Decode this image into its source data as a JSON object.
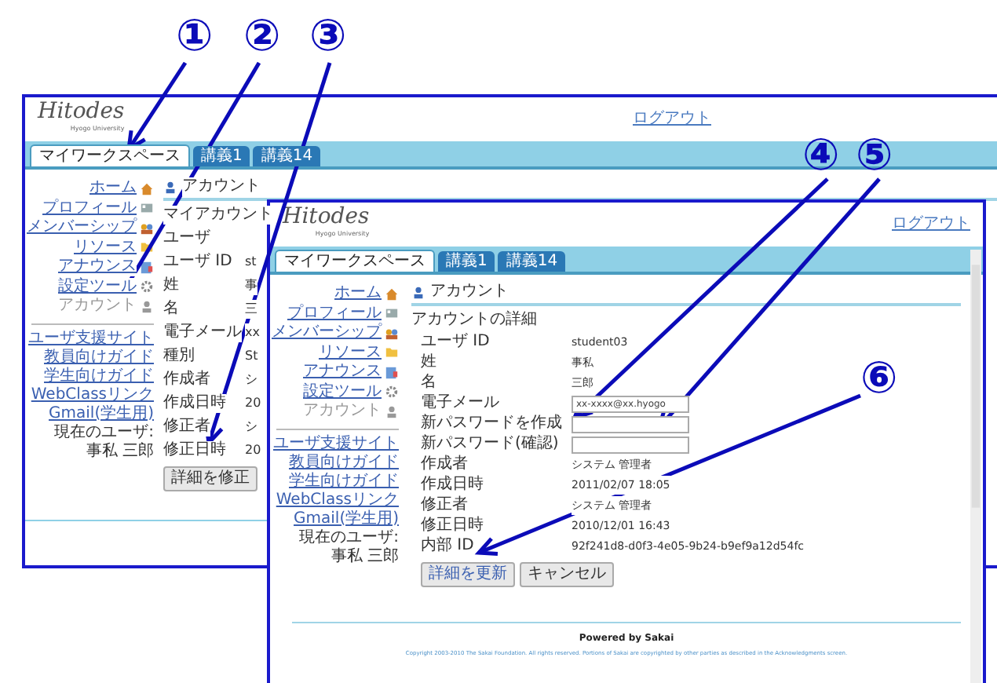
{
  "callouts": [
    {
      "label": "①"
    },
    {
      "label": "②"
    },
    {
      "label": "③"
    },
    {
      "label": "④"
    },
    {
      "label": "⑤"
    },
    {
      "label": "⑥"
    }
  ],
  "back_window": {
    "logo": "Hitodes",
    "logo_subtitle": "Hyogo University",
    "logout": "ログアウト",
    "tabs": [
      {
        "label": "マイワークスペース",
        "selected": true
      },
      {
        "label": "講義1",
        "selected": false
      },
      {
        "label": "講義14",
        "selected": false
      }
    ],
    "sidebar": {
      "tools": [
        {
          "label": "ホーム",
          "selected": false
        },
        {
          "label": "プロフィール",
          "selected": false
        },
        {
          "label": "メンバーシップ",
          "selected": false
        },
        {
          "label": "リソース",
          "selected": false
        },
        {
          "label": "アナウンス",
          "selected": false
        },
        {
          "label": "設定ツール",
          "selected": false
        },
        {
          "label": "アカウント",
          "selected": true
        }
      ],
      "links": [
        "ユーザ支援サイト",
        "教員向けガイド",
        "学生向けガイド",
        "WebClassリンク",
        "Gmail(学生用)"
      ],
      "current_user_label": "現在のユーザ:",
      "current_user": "事私 三郎"
    },
    "heading": "アカウント",
    "subheading": "マイアカウント",
    "section": "ユーザ",
    "rows": [
      {
        "label": "ユーザ ID",
        "value": "st"
      },
      {
        "label": "姓",
        "value": "事"
      },
      {
        "label": "名",
        "value": "三"
      },
      {
        "label": "電子メール",
        "value": "xx"
      },
      {
        "label": "種別",
        "value": "St"
      },
      {
        "label": "作成者",
        "value": "シ"
      },
      {
        "label": "作成日時",
        "value": "20"
      },
      {
        "label": "修正者",
        "value": "シ"
      },
      {
        "label": "修正日時",
        "value": "20"
      }
    ],
    "button": "詳細を修正"
  },
  "front_window": {
    "logo": "Hitodes",
    "logo_subtitle": "Hyogo University",
    "logout": "ログアウト",
    "tabs": [
      {
        "label": "マイワークスペース",
        "selected": true
      },
      {
        "label": "講義1",
        "selected": false
      },
      {
        "label": "講義14",
        "selected": false
      }
    ],
    "sidebar": {
      "tools": [
        {
          "label": "ホーム",
          "selected": false
        },
        {
          "label": "プロフィール",
          "selected": false
        },
        {
          "label": "メンバーシップ",
          "selected": false
        },
        {
          "label": "リソース",
          "selected": false
        },
        {
          "label": "アナウンス",
          "selected": false
        },
        {
          "label": "設定ツール",
          "selected": false
        },
        {
          "label": "アカウント",
          "selected": true
        }
      ],
      "links": [
        "ユーザ支援サイト",
        "教員向けガイド",
        "学生向けガイド",
        "WebClassリンク",
        "Gmail(学生用)"
      ],
      "current_user_label": "現在のユーザ:",
      "current_user": "事私 三郎"
    },
    "heading": "アカウント",
    "subheading": "アカウントの詳細",
    "rows": [
      {
        "label": "ユーザ ID",
        "kind": "text",
        "value": "student03"
      },
      {
        "label": "姓",
        "kind": "text",
        "value": "事私"
      },
      {
        "label": "名",
        "kind": "text",
        "value": "三郎"
      },
      {
        "label": "電子メール",
        "kind": "input",
        "value": "xx-xxxx@xx.hyogo"
      },
      {
        "label": "新パスワードを作成",
        "kind": "input"
      },
      {
        "label": "新パスワード(確認)",
        "kind": "input"
      },
      {
        "label": "作成者",
        "kind": "text",
        "value": "システム 管理者"
      },
      {
        "label": "作成日時",
        "kind": "text",
        "value": "2011/02/07 18:05"
      },
      {
        "label": "修正者",
        "kind": "text",
        "value": "システム 管理者"
      },
      {
        "label": "修正日時",
        "kind": "text",
        "value": "2010/12/01 16:43"
      },
      {
        "label": "内部 ID",
        "kind": "text",
        "value": "92f241d8-d0f3-4e05-9b24-b9ef9a12d54fc"
      }
    ],
    "buttons": [
      "詳細を更新",
      "キャンセル"
    ],
    "footer": "Powered by Sakai",
    "copyright": "Copyright 2003-2010 The Sakai Foundation. All rights reserved. Portions of Sakai are copyrighted by other parties as described in the Acknowledgments screen."
  }
}
